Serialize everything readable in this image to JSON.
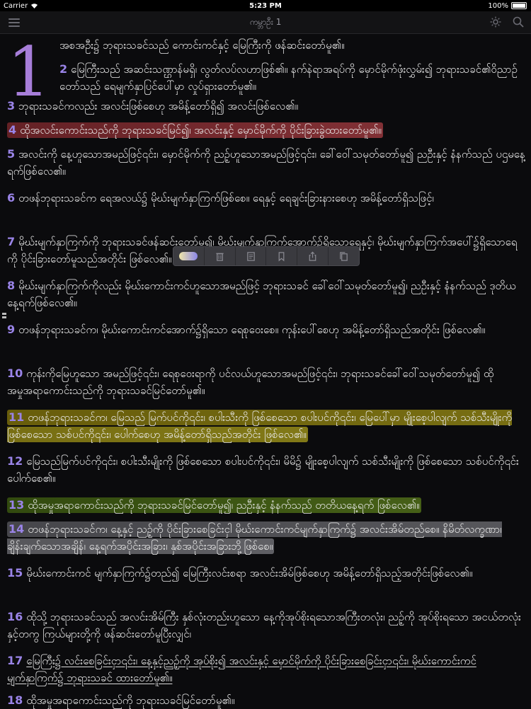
{
  "status": {
    "carrier": "Carrier",
    "time": "5:23 PM",
    "battery": "100%"
  },
  "nav": {
    "title": "ကမ္ဘာဦး 1"
  },
  "chapter": "1",
  "verses": [
    {
      "n": "",
      "text": "အစအဦး၌ ဘုရားသခင်သည် ကောင်းကင်နှင့် မြေကြီးကို ဖန်ဆင်းတော်မူ၏။"
    },
    {
      "n": "2",
      "text": "မြေကြီးသည် အဆင်းသဏ္ဌာန်မရှိ၊ လွတ်လပ်လဟာဖြစ်၏။ နက်နဲရာအရပ်ကို မှောင်မိုက်ဖုံးလွှမ်း၍ ဘုရားသခင်၏ဝိညာဉ်တော်သည် ရေမျက်နှာပြင်ပေါ်မှာ လှုပ်ရှားတော်မူ၏။"
    },
    {
      "n": "3",
      "text": "ဘုရားသခင်ကလည်း အလင်းဖြစ်စေဟု အမိန့်တော်ရှိ၍ အလင်းဖြစ်လေ၏။"
    },
    {
      "n": "4",
      "text": "ထိုအလင်းကောင်းသည်ကို ဘုရားသခင်မြင်၍၊ အလင်းနှင့် မှောင်မိုက်ကို ပိုင်းခြားခွဲထားတော်မူ၏။"
    },
    {
      "n": "5",
      "text": "အလင်းကို နေ့ဟူသောအမည်ဖြင့်၎င်း၊ မှောင်မိုက်ကို ညဉ့်ဟူသောအမည်ဖြင့်၎င်း၊ ခေါ်ဝေါ်သမုတ်တော်မူ၍ ညဦးနှင့် နံနက်သည် ပဌမနေ့ရက်ဖြစ်လေ၏။"
    },
    {
      "n": "6",
      "text": "တဖန်ဘုရားသခင်က ရေအလယ်၌ မိုဃ်းမျက်နှာကြက်ဖြစ်စေ။ ရေနှင့် ရေချင်းခြားနားစေဟု အမိန့်တော်ရှိသဖြင့်၊"
    },
    {
      "n": "7",
      "text": "မိုဃ်းမျက်နှာကြက်ကို ဘုရားသခင်ဖန်ဆင်းတော်မူ၍၊ မိုဃ်းမျက်နှာကြက်အောက်၌ရှိသောရေနှင့်၊ မိုဃ်းမျက်နှာကြက်အပေါ်၌ရှိသောရေကို ပိုင်းခြားတော်မူသည်အတိုင်း ဖြစ်လေ၏။"
    },
    {
      "n": "8",
      "text": "မိုဃ်းမျက်နှာကြက်ကိုလည်း မိုဃ်းကောင်းကင်ဟူသောအမည်ဖြင့် ဘုရားသခင် ခေါ်ဝေါ်သမုတ်တော်မူ၍၊ ညဦးနှင့် နံနက်သည် ဒုတိယနေ့ရက်ဖြစ်လေ၏။"
    },
    {
      "n": "9",
      "text": "တဖန်ဘုရားသခင်က၊ မိုဃ်းကောင်းကင်အောက်၌ရှိသော ရေစုဝေးစေ။ ကုန်းပေါ်စေဟု အမိန့်တော်ရှိသည်အတိုင်း ဖြစ်လေ၏။"
    },
    {
      "n": "10",
      "text": "ကုန်းကိုမြေဟူသော အမည်ဖြင့်၎င်း၊ ရေစုဝေးရာကို ပင်လယ်ဟူသောအမည်ဖြင့်၎င်း၊ ဘုရားသခင်ခေါ်ဝေါ်သမုတ်တော်မူ၍ ထိုအမှုအရာကောင်းသည်ကို ဘုရားသခင်မြင်တော်မူ၏။"
    },
    {
      "n": "11",
      "text": "တဖန်ဘုရားသခင်က၊ မြေသည် မြက်ပင်ကို၎င်း၊ စပါးသီးကို ဖြစ်စေသော စပါးပင်ကို၎င်း၊ မြေပေါ်မှာ မျိုးစေ့ပါလျက် သစ်သီးမျိုးကို ဖြစ်စေသော သစ်ပင်ကို၎င်း၊ ပေါက်စေဟု အမိန့်တော်ရှိသည်အတိုင်း ဖြစ်လေ၏။"
    },
    {
      "n": "12",
      "text": "မြေသည်မြက်ပင်ကို၎င်း၊ စပါးသီးမျိုးကို ဖြစ်စေသော စပါးပင်ကို၎င်း၊ မိမိ၌ မျိုးစေ့ပါလျက် သစ်သီးမျိုးကို ဖြစ်စေသော သစ်ပင်ကို၎င်း ပေါက်စေ၏။"
    },
    {
      "n": "13",
      "text": "ထိုအမှုအရာကောင်းသည်ကို ဘုရားသခင်မြင်တော်မူ၍၊ ညဦးနှင့် နံနက်သည် တတိယနေ့ရက် ဖြစ်လေ၏။"
    },
    {
      "n": "14",
      "text": "တဖန်ဘုရားသခင်က၊ နေ့နှင့် ညဉ့်ကို ပိုင်းခြားစေခြင်းငှါ မိုဃ်းကောင်းကင်မျက်နှာကြက်၌ အလင်းအိမ်တည်စေ။ နိမိတ်လက္ခဏာ၊ ချိန်းချက်သောအချိန်၊ နေ့ရက်အပိုင်းအခြား၊ နှစ်အပိုင်းအခြားဘို့ဖြစ်စေ။"
    },
    {
      "n": "15",
      "text": "မိုဃ်းကောင်းကင် မျက်နှာကြက်၌တည်၍ မြေကြီးလင်းစရာ အလင်းအိမ်ဖြစ်စေဟု အမိန့်တော်ရှိသည့်အတိုင်းဖြစ်လေ၏။"
    },
    {
      "n": "16",
      "text": "ထိုသို့ ဘုရားသခင်သည် အလင်းအိမ်ကြီး နှစ်လုံးတည်းဟူသော နေ့ကိုအုပ်စိုးရသောအကြီးတလုံး၊ ညဉ့်ကို အုပ်စိုးရသော အငယ်တလုံးနှင့်တကွ ကြယ်များတို့ကို ဖန်ဆင်းတော်မူပြီးလျှင်၊"
    },
    {
      "n": "17",
      "text": "မြေကြီး၌ လင်းစေခြင်းငှာ၎င်း၊ နေ့နှင့်ညဉ့်ကို အုပ်စိုး၍ အလင်းနှင့် မှောင်မိုက်ကို ပိုင်းခြားစေခြင်းငှာ၎င်း၊ မိုဃ်းကောင်းကင်မျက်နှာကြက်၌ ဘုရားသခင် ထားတော်မူ၏။"
    },
    {
      "n": "18",
      "text": "ထိုအမှုအရာကောင်းသည်ကို ဘုရားသခင်မြင်တော်မူ၏။"
    }
  ],
  "toolbar": {
    "items": [
      "highlight-toggle",
      "trash-icon",
      "note-icon",
      "bookmark-icon",
      "share-icon",
      "copy-icon"
    ]
  },
  "colors": {
    "verse_number": "#9a84e8",
    "chapter_number": "#a77ed9",
    "highlight_red": "#8a2d33",
    "highlight_yellow": "#8f7f12",
    "highlight_green": "#4b6b18",
    "highlight_gray": "#5f5f64"
  }
}
